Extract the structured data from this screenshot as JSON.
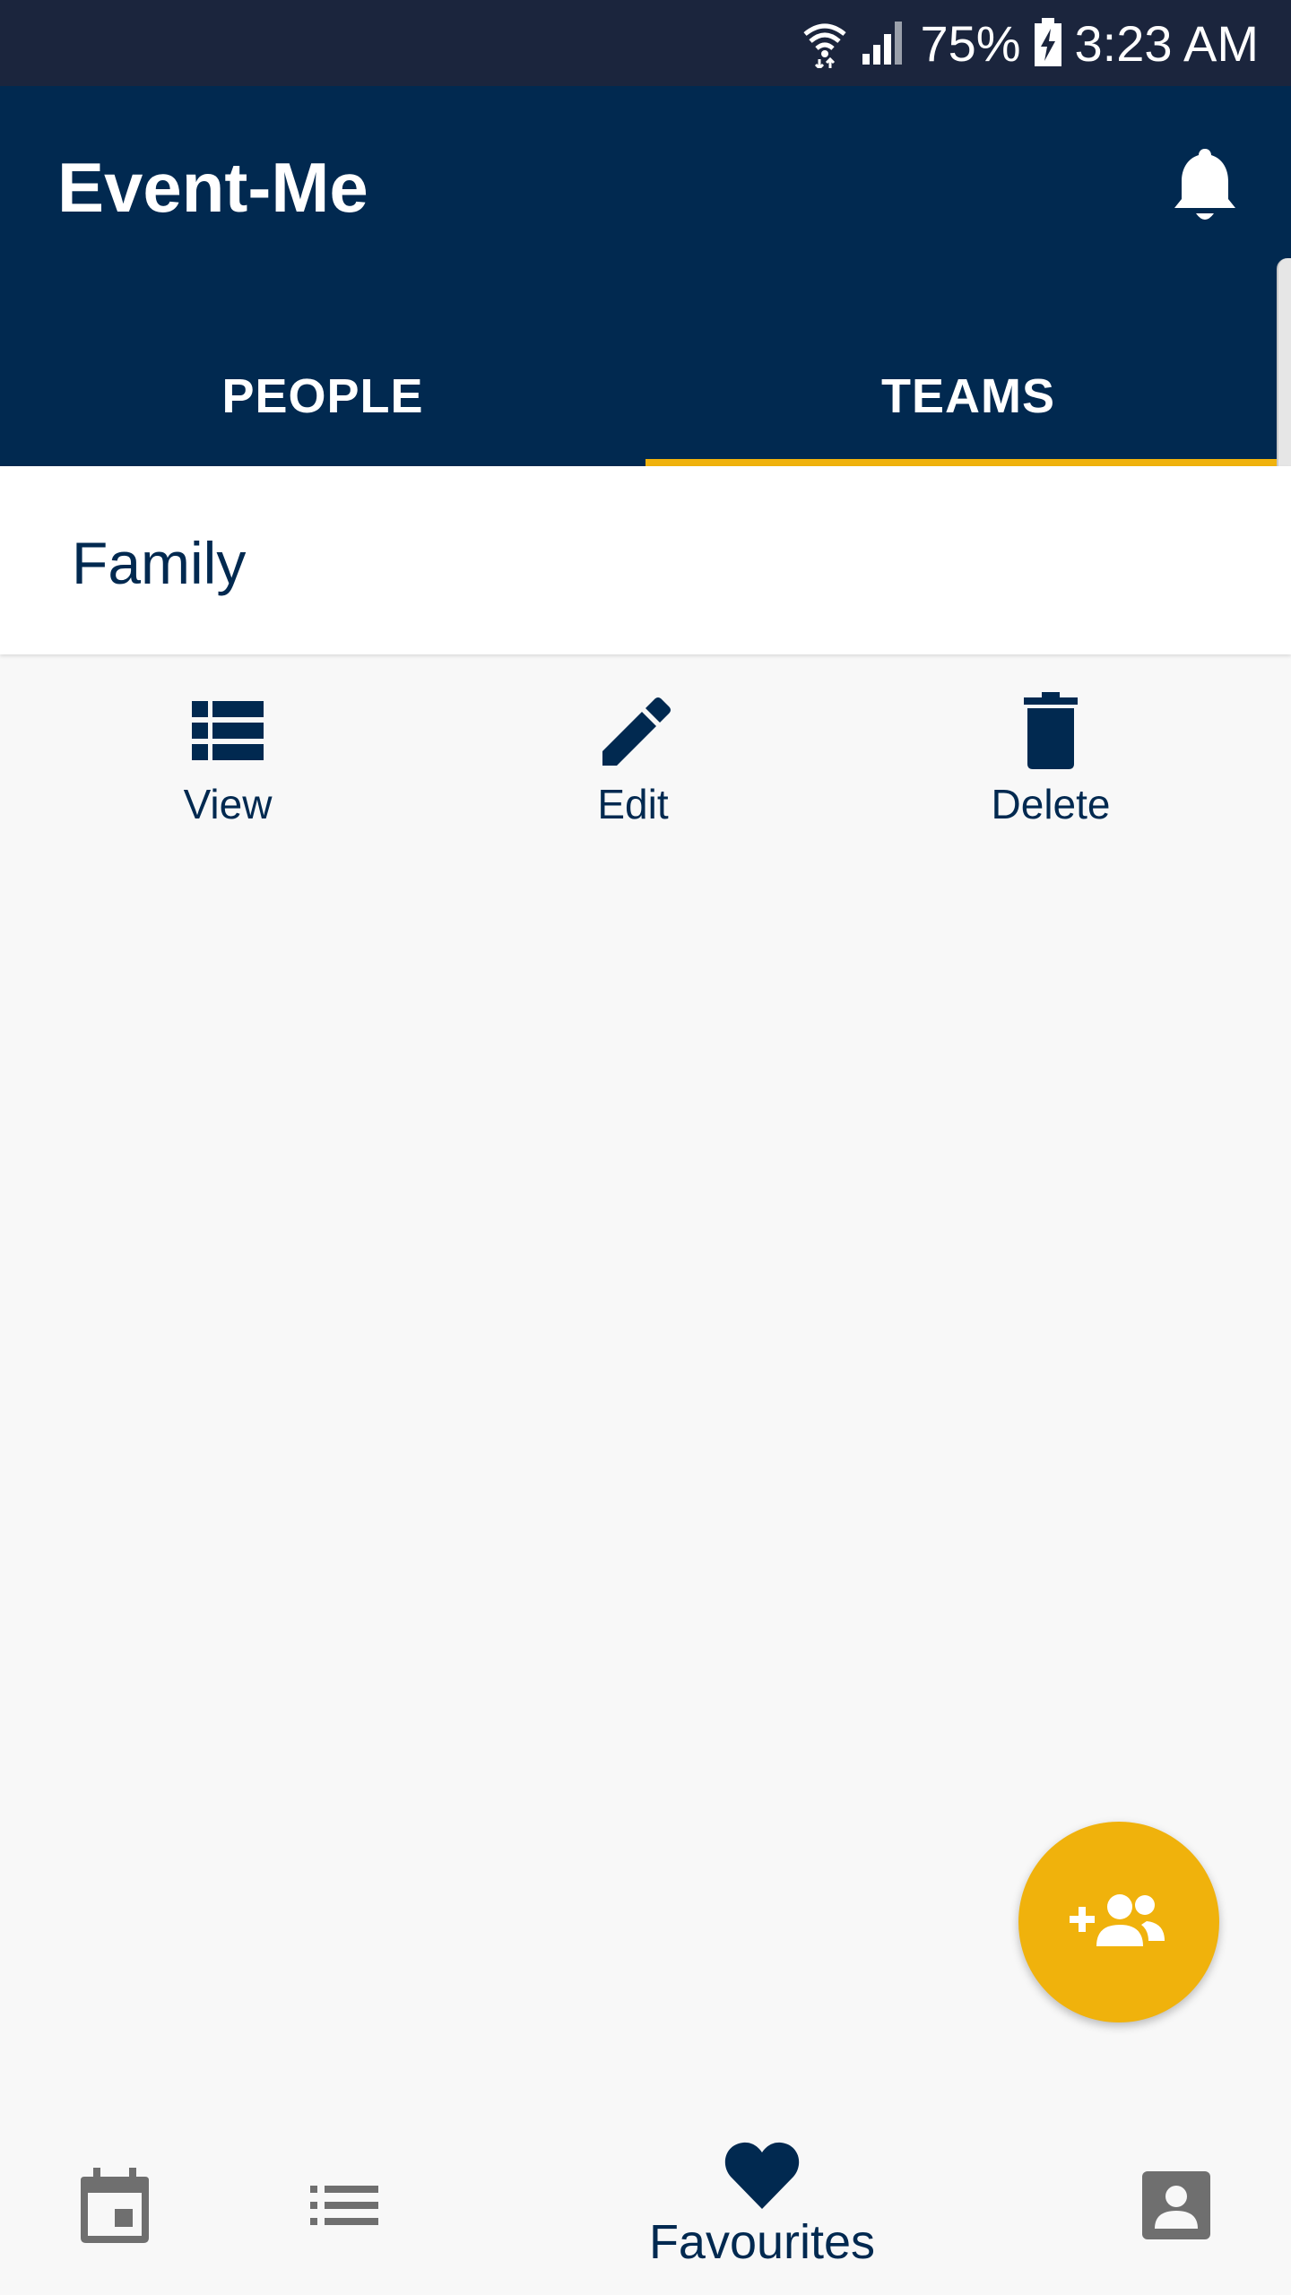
{
  "status_bar": {
    "battery": "75%",
    "time": "3:23 AM"
  },
  "app": {
    "title": "Event-Me"
  },
  "tabs": [
    {
      "label": "PEOPLE",
      "active": false
    },
    {
      "label": "TEAMS",
      "active": true
    }
  ],
  "team_card": {
    "name": "Family"
  },
  "actions": {
    "view": "View",
    "edit": "Edit",
    "delete": "Delete"
  },
  "bottom_nav": {
    "favourites": "Favourites"
  },
  "colors": {
    "status_bar": "#1b253d",
    "primary": "#012950",
    "accent": "#f0b20c",
    "background": "#f8f8f8",
    "nav_inactive": "#6f6f6f"
  },
  "icons": {
    "status": [
      "wifi-icon",
      "signal-icon",
      "battery-charging-icon"
    ],
    "app_bar": [
      "bell-icon"
    ],
    "actions": [
      "view-list-icon",
      "edit-pencil-icon",
      "delete-trash-icon"
    ],
    "fab": "group-add-icon",
    "bottom_nav": [
      "calendar-icon",
      "list-icon",
      "heart-icon",
      "account-box-icon"
    ]
  }
}
